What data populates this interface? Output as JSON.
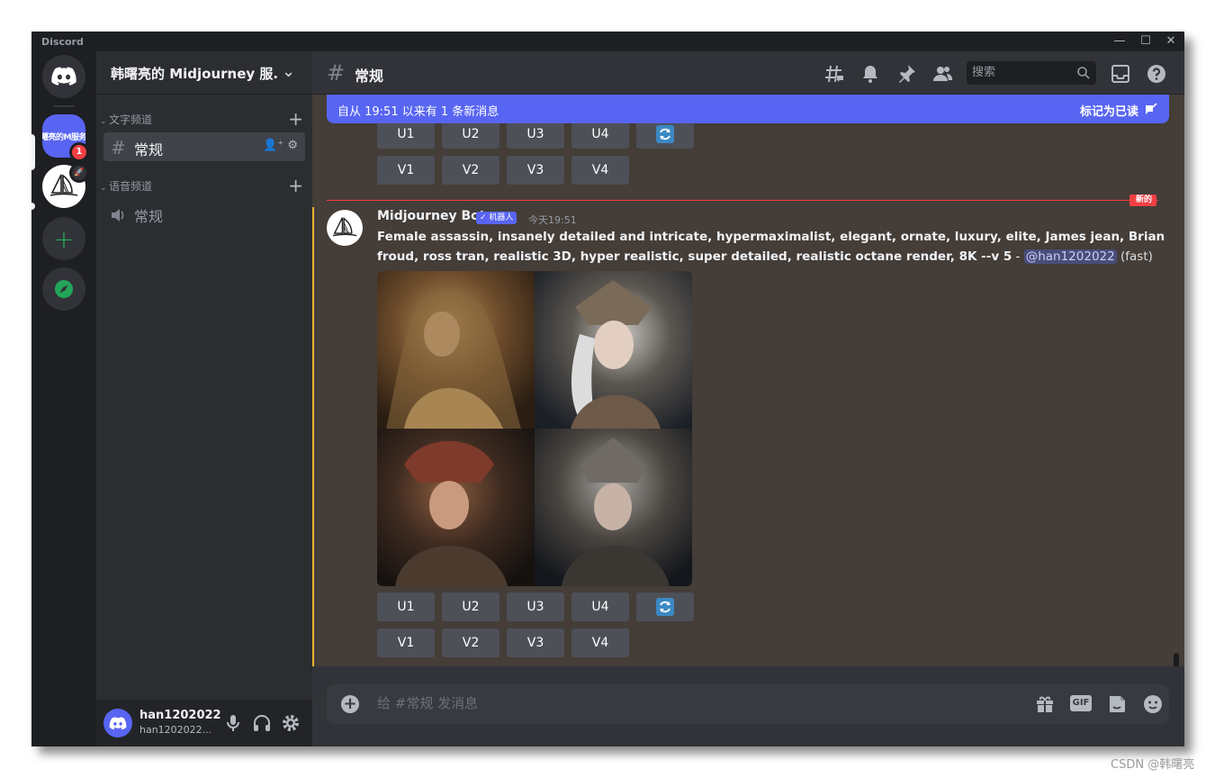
{
  "app": {
    "title": "Discord"
  },
  "window_controls": {
    "minimize": "—",
    "maximize": "☐",
    "close": "✕"
  },
  "servers": {
    "home_icon": "discord-logo-icon",
    "midjourney_server_label": "曙亮的M服务",
    "mention_count": "1",
    "add_icon": "plus-icon",
    "explore_icon": "compass-icon"
  },
  "sidebar": {
    "server_name": "韩曙亮的 Midjourney 服...",
    "text_category": "文字频道",
    "text_channel": "常规",
    "voice_category": "语音频道",
    "voice_channel": "常规"
  },
  "user": {
    "name": "han1202022",
    "tag": "han1202022..."
  },
  "header": {
    "channel_name": "常规",
    "search_placeholder": "搜索"
  },
  "banner": {
    "text": "自从 19:51 以来有 1 条新消息",
    "mark_read": "标记为已读"
  },
  "buttons": {
    "upscale": [
      "U1",
      "U2",
      "U3",
      "U4"
    ],
    "variation": [
      "V1",
      "V2",
      "V3",
      "V4"
    ]
  },
  "divider": {
    "label": "新的"
  },
  "message": {
    "author": "Midjourney Bot",
    "bot_tag": "✓ 机器人",
    "time": "今天19:51",
    "prompt_line1": "Female assassin, insanely detailed and intricate, hypermaximalist, elegant, ornate, luxury, elite, James jean, Brian",
    "prompt_line2": "froud, ross tran, realistic 3D, hyper realistic, super detailed, realistic octane render, 8K --v 5",
    "separator": " - ",
    "mention": "@han1202022",
    "mode": "(fast)"
  },
  "composer": {
    "placeholder": "给 #常规 发消息",
    "gif_label": "GIF"
  },
  "watermark": "CSDN @韩曙亮",
  "colors": {
    "blurple": "#5865f2",
    "new_red": "#f23f43",
    "highlight": "#f0b232"
  }
}
